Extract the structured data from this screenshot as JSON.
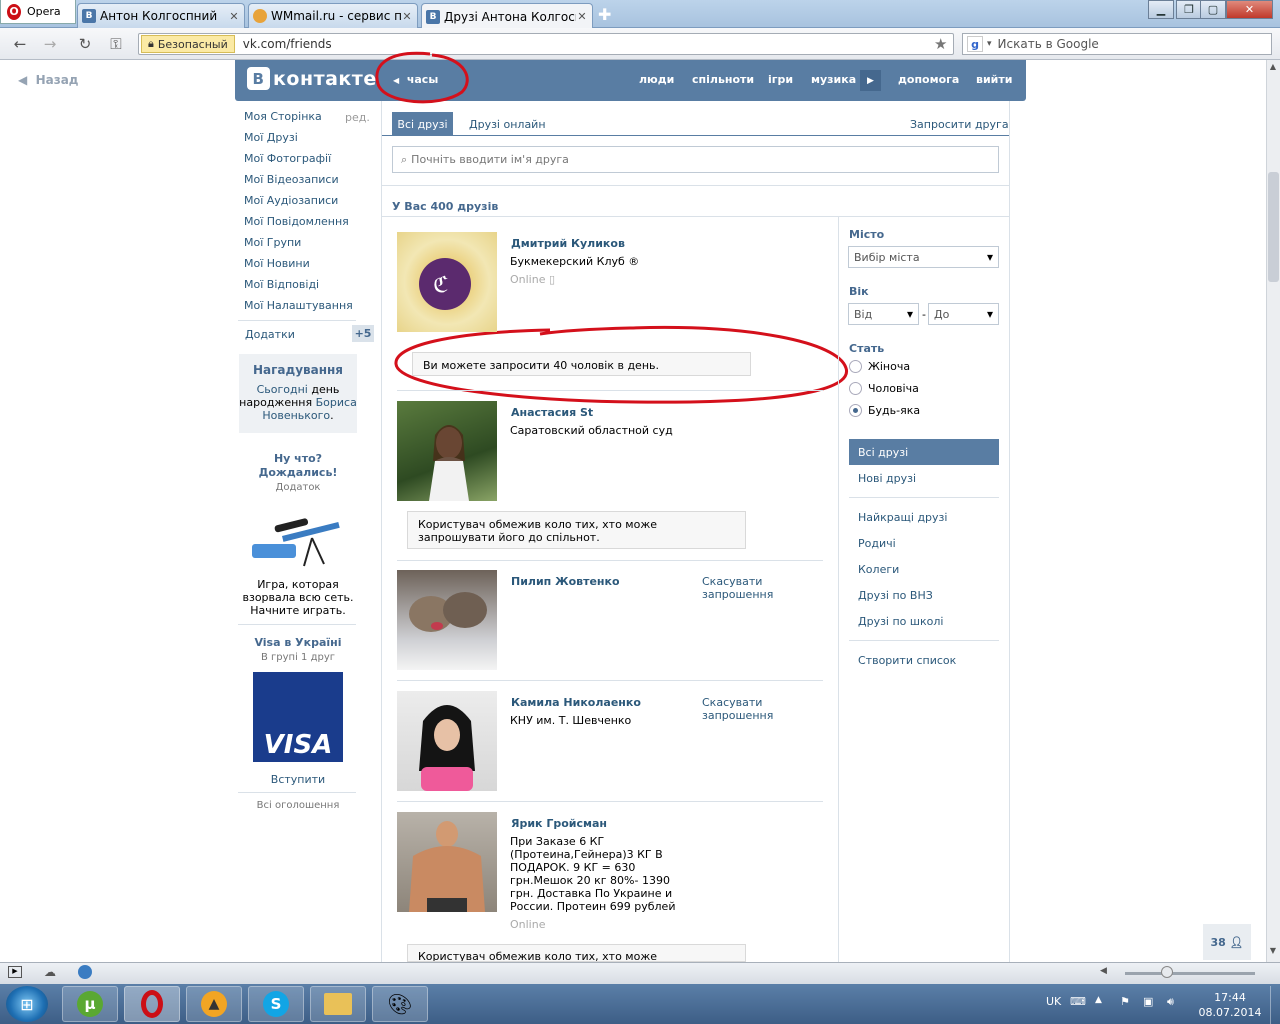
{
  "browser": {
    "menu_label": "Opera",
    "tabs": [
      {
        "title": "Антон Колгоспний"
      },
      {
        "title": "WMmail.ru - сервис п..."
      },
      {
        "title": "Друзі Антона Колгосп..."
      }
    ],
    "security_label": "Безопасный",
    "url": "vk.com/friends",
    "search_placeholder": "Искать в Google",
    "back_label": "Назад"
  },
  "vk": {
    "logo": "контакте",
    "logo_letter": "В",
    "clock_label": "часы",
    "nav": [
      "люди",
      "спільноти",
      "ігри",
      "музика",
      "допомога",
      "вийти"
    ]
  },
  "left_menu": {
    "items": [
      "Моя Сторінка",
      "Мої Друзі",
      "Мої Фотографії",
      "Мої Відеозаписи",
      "Мої Аудіозаписи",
      "Мої Повідомлення",
      "Мої Групи",
      "Мої Новини",
      "Мої Відповіді",
      "Мої Налаштування"
    ],
    "edit_label": "ред.",
    "apps_label": "Додатки",
    "apps_badge": "+5",
    "reminder_title": "Нагадування",
    "reminder_link1": "Сьогодні",
    "reminder_text": "день народження",
    "reminder_link2": "Бориса Новенького",
    "ad1_title": "Ну что? Дождались!",
    "ad1_sub": "Додаток",
    "ad1_text": "Игра, которая взорвала всю сеть. Начните играть.",
    "ad2_title": "Visa в Україні",
    "ad2_sub": "В групі 1 друг",
    "ad2_logo": "VISA",
    "ad2_join": "Вступити",
    "all_ads": "Всі оголошення"
  },
  "main": {
    "tab_all": "Всі друзі",
    "tab_online": "Друзі онлайн",
    "invite": "Запросити друга",
    "filter_placeholder": "Почніть вводити ім'я друга",
    "count_label": "У Вас 400 друзів",
    "friends": [
      {
        "name": "Дмитрий Куликов",
        "info": "Букмекерский Клуб ®",
        "status": "Online"
      },
      {
        "name": "Анастасия St",
        "info": "Саратовский областной суд"
      },
      {
        "name": "Пилип Жовтенко",
        "action": "Скасувати запрошення"
      },
      {
        "name": "Камила Николаенко",
        "info": "КНУ им. Т. Шевченко",
        "action": "Скасувати запрошення"
      },
      {
        "name": "Ярик Гройсман",
        "info": "При Заказе 6 КГ (Протеина,Гейнера)3 КГ В ПОДАРОК. 9 КГ = 630 грн.Мешок 20 кг 80%- 1390 грн. Доставка По Украине и России. Протеин 699 рублей",
        "status": "Online"
      }
    ],
    "notice_limit": "Ви можете запросити 40 чоловік в день.",
    "notice_restricted": "Користувач обмежив коло тих, хто може запрошувати його до спільнот.",
    "notice_restricted_partial": "Користувач обмежив коло тих, хто може запрошувати його"
  },
  "filter": {
    "city_label": "Місто",
    "city_value": "Вибір міста",
    "age_label": "Вік",
    "age_from": "Від",
    "age_dash": "-",
    "age_to": "До",
    "gender_label": "Стать",
    "genders": [
      "Жіноча",
      "Чоловіча",
      "Будь-яка"
    ],
    "lists": [
      "Всі друзі",
      "Нові друзі",
      "Найкращі друзі",
      "Родичі",
      "Колеги",
      "Друзі по ВНЗ",
      "Друзі по школі",
      "Створити список"
    ]
  },
  "footer_badge": "38",
  "system": {
    "lang": "UK",
    "time": "17:44",
    "date": "08.07.2014"
  },
  "colors": {
    "vk_blue": "#597da3",
    "link": "#2b587a",
    "annotation": "#d4101b"
  }
}
